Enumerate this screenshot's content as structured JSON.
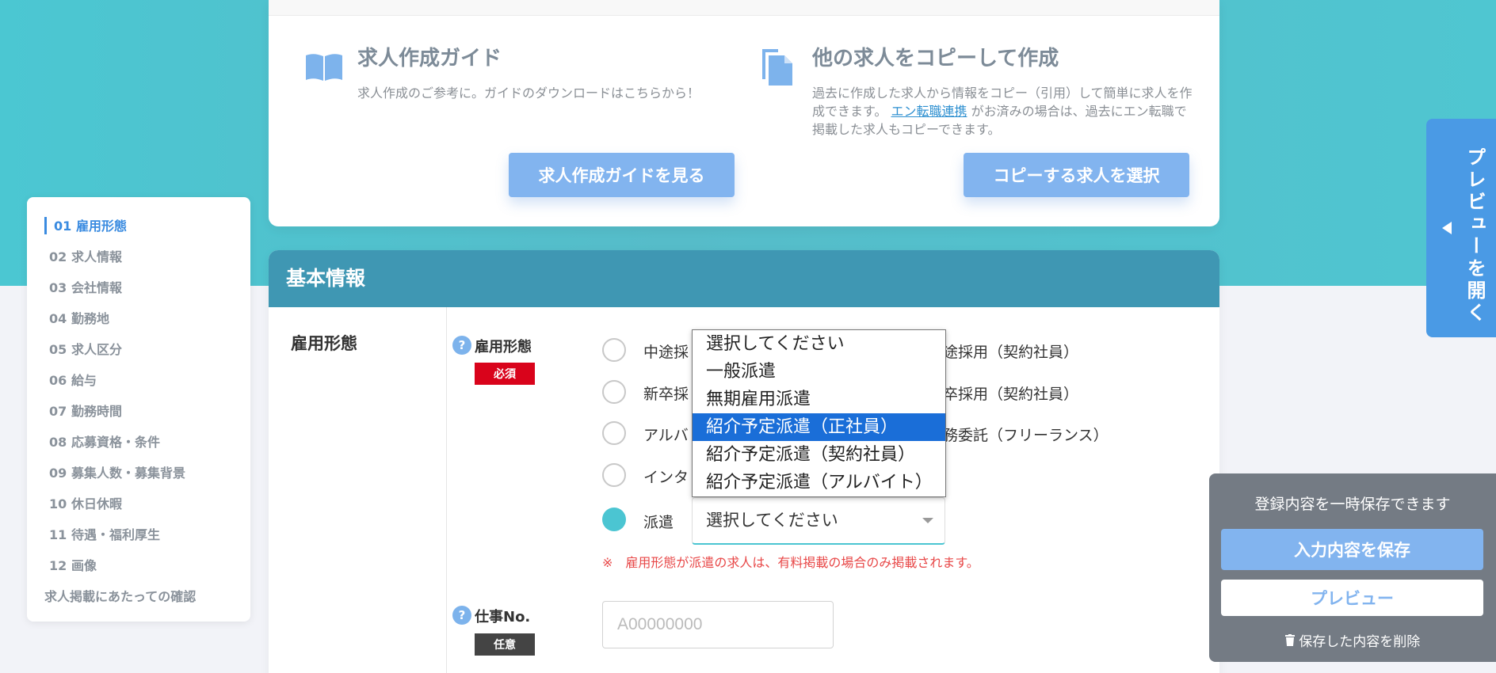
{
  "guide": {
    "title": "求人作成ガイド",
    "desc": "求人作成のご参考に。ガイドのダウンロードはこちらから！",
    "button": "求人作成ガイドを見る"
  },
  "copy": {
    "title": "他の求人をコピーして作成",
    "desc_part1": "過去に作成した求人から情報をコピー（引用）して簡単に求人を作成できます。",
    "link": "エン転職連携",
    "desc_part2": "がお済みの場合は、過去にエン転職で掲載した求人もコピーできます。",
    "button": "コピーする求人を選択"
  },
  "nav": {
    "items": [
      {
        "num": "01",
        "label": "雇用形態"
      },
      {
        "num": "02",
        "label": "求人情報"
      },
      {
        "num": "03",
        "label": "会社情報"
      },
      {
        "num": "04",
        "label": "勤務地"
      },
      {
        "num": "05",
        "label": "求人区分"
      },
      {
        "num": "06",
        "label": "給与"
      },
      {
        "num": "07",
        "label": "勤務時間"
      },
      {
        "num": "08",
        "label": "応募資格・条件"
      },
      {
        "num": "09",
        "label": "募集人数・募集背景"
      },
      {
        "num": "10",
        "label": "休日休暇"
      },
      {
        "num": "11",
        "label": "待遇・福利厚生"
      },
      {
        "num": "12",
        "label": "画像"
      }
    ],
    "confirm": "求人掲載にあたっての確認"
  },
  "main": {
    "header": "基本情報",
    "section_label": "雇用形態",
    "field_label": "雇用形態",
    "required_badge": "必須",
    "options": {
      "mid_prefix": "中途採",
      "mid_contract_suffix": "途採用（契約社員）",
      "new_prefix": "新卒採",
      "new_contract_suffix": "卒採用（契約社員）",
      "arbeit_prefix": "アルバ",
      "freelance_suffix": "務委託（フリーランス）",
      "intern_prefix": "インタ",
      "haken": "派遣"
    },
    "select_value": "選択してください",
    "note": "※　雇用形態が派遣の求人は、有料掲載の場合のみ掲載されます。",
    "job_no_label": "仕事No.",
    "optional_badge": "任意",
    "job_no_placeholder": "A00000000"
  },
  "dropdown": {
    "options": [
      "選択してください",
      "一般派遣",
      "無期雇用派遣",
      "紹介予定派遣（正社員）",
      "紹介予定派遣（契約社員）",
      "紹介予定派遣（アルバイト）"
    ],
    "selected": "紹介予定派遣（正社員）"
  },
  "preview_tab": {
    "label": "プレビューを開く"
  },
  "save_panel": {
    "text": "登録内容を一時保存できます",
    "save_button": "入力内容を保存",
    "preview_button": "プレビュー",
    "delete_link": "保存した内容を削除"
  },
  "colors": {
    "teal": "#4bc7d2",
    "header_blue": "#3f97b3",
    "button_blue": "#82b4ef",
    "accent_blue": "#3a8be0",
    "required_red": "#d9031b",
    "dropdown_selected": "#1a6ed8"
  }
}
